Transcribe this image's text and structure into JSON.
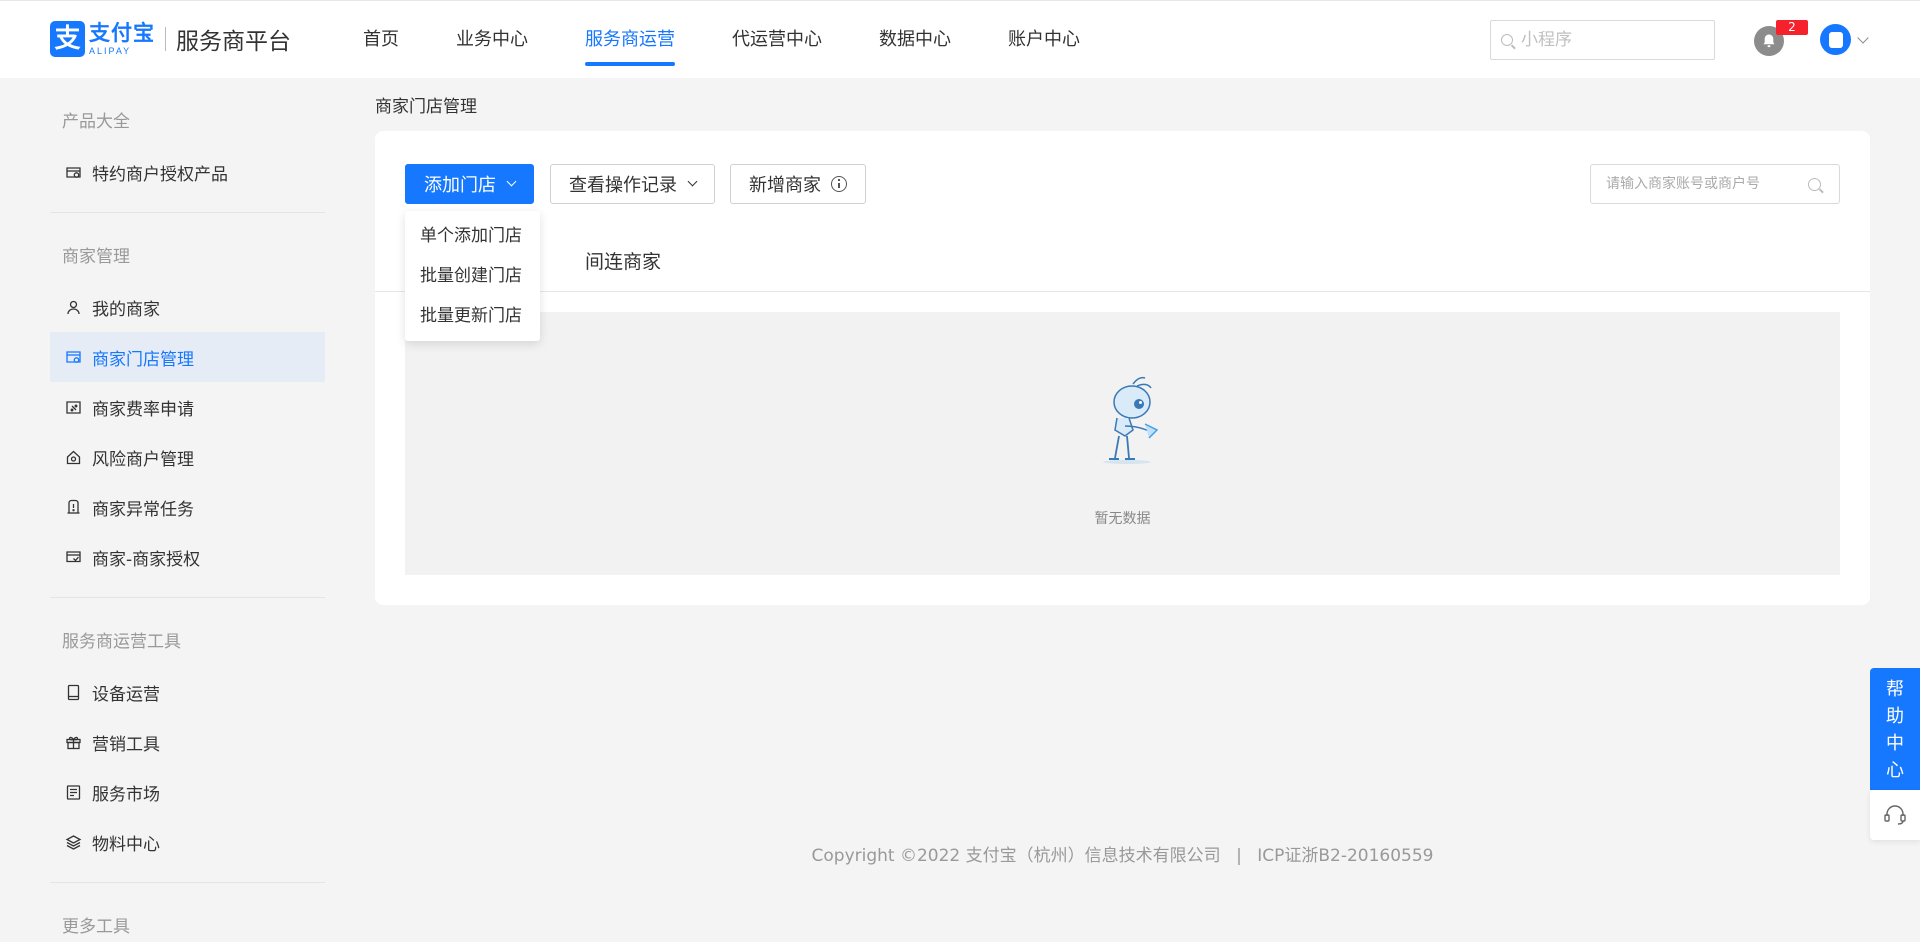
{
  "header": {
    "logo": {
      "mark": "支",
      "cn": "支付宝",
      "en": "ALIPAY"
    },
    "platform_name": "服务商平台",
    "nav": [
      {
        "label": "首页",
        "active": false
      },
      {
        "label": "业务中心",
        "active": false
      },
      {
        "label": "服务商运营",
        "active": true
      },
      {
        "label": "代运营中心",
        "active": false
      },
      {
        "label": "数据中心",
        "active": false
      },
      {
        "label": "账户中心",
        "active": false
      }
    ],
    "search_placeholder": "小程序",
    "notification_count": "2",
    "accent_color": "#1677ff"
  },
  "sidebar": {
    "groups": [
      {
        "title": "产品大全",
        "items": [
          {
            "label": "特约商户授权产品",
            "icon": "store-license-icon"
          }
        ]
      },
      {
        "title": "商家管理",
        "items": [
          {
            "label": "我的商家",
            "icon": "user-icon"
          },
          {
            "label": "商家门店管理",
            "icon": "store-settings-icon",
            "active": true
          },
          {
            "label": "商家费率申请",
            "icon": "rate-icon"
          },
          {
            "label": "风险商户管理",
            "icon": "risk-home-icon"
          },
          {
            "label": "商家异常任务",
            "icon": "alert-flag-icon"
          },
          {
            "label": "商家-商家授权",
            "icon": "authorize-icon"
          }
        ]
      },
      {
        "title": "服务商运营工具",
        "items": [
          {
            "label": "设备运营",
            "icon": "device-icon"
          },
          {
            "label": "营销工具",
            "icon": "gift-icon"
          },
          {
            "label": "服务市场",
            "icon": "document-icon"
          },
          {
            "label": "物料中心",
            "icon": "layers-icon"
          }
        ]
      },
      {
        "title": "更多工具",
        "items": []
      }
    ]
  },
  "main": {
    "page_title": "商家门店管理",
    "buttons": {
      "add_store": "添加门店",
      "view_records": "查看操作记录",
      "add_merchant": "新增商家"
    },
    "search_placeholder": "请输入商家账号或商户号",
    "tab": "间连商家",
    "dropdown": [
      "单个添加门店",
      "批量创建门店",
      "批量更新门店"
    ],
    "empty_text": "暂无数据"
  },
  "footer": {
    "copyright": "Copyright ©2022 支付宝（杭州）信息技术有限公司",
    "separator": "|",
    "icp": "ICP证浙B2-20160559"
  },
  "help": {
    "chars": [
      "帮",
      "助",
      "中",
      "心"
    ]
  }
}
